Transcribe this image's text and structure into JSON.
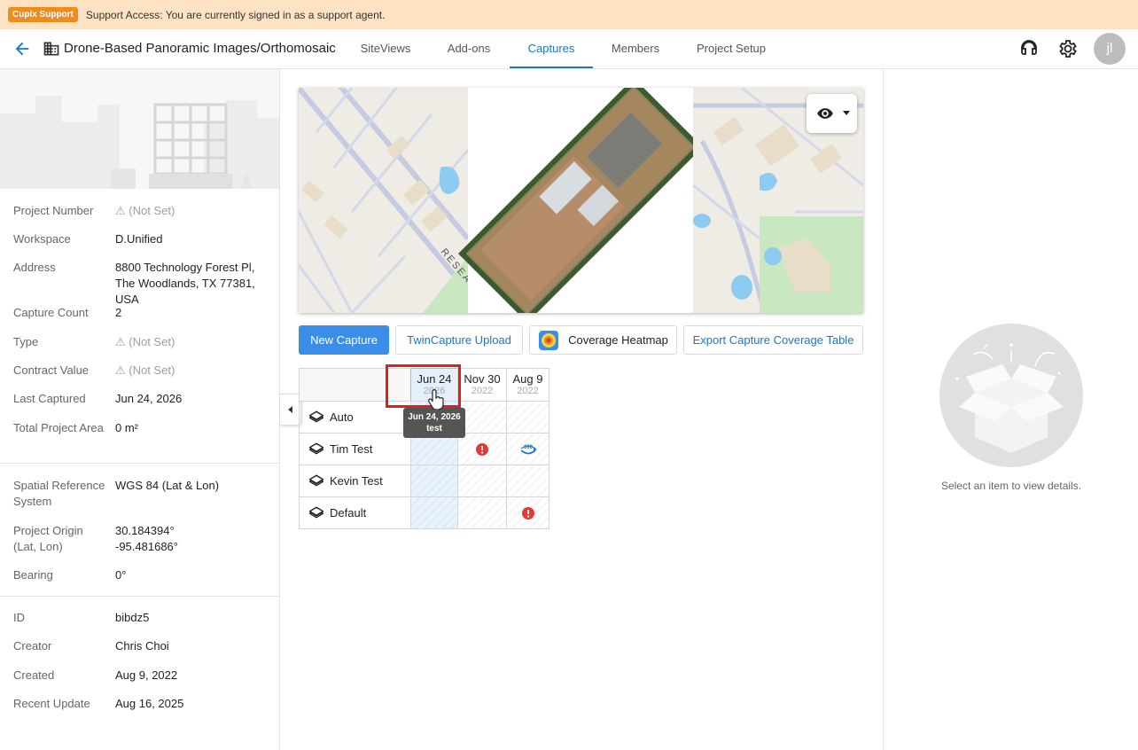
{
  "banner": {
    "badge": "Cupix Support",
    "message": "Support Access: You are currently signed in as a support agent."
  },
  "header": {
    "project_title": "Drone-Based Panoramic Images/Orthomosaic",
    "tabs": [
      {
        "label": "SiteViews"
      },
      {
        "label": "Add-ons"
      },
      {
        "label": "Captures",
        "active": true
      },
      {
        "label": "Members"
      },
      {
        "label": "Project Setup"
      }
    ],
    "avatar_initials": "jl"
  },
  "properties": {
    "project_number": {
      "label": "Project Number",
      "value": "⚠ (Not Set)"
    },
    "workspace": {
      "label": "Workspace",
      "value": "D.Unified"
    },
    "address": {
      "label": "Address",
      "value": "8800 Technology Forest Pl, The Woodlands, TX 77381, USA"
    },
    "capture_count": {
      "label": "Capture Count",
      "value": "2"
    },
    "type": {
      "label": "Type",
      "value": "⚠ (Not Set)"
    },
    "contract_value": {
      "label": "Contract Value",
      "value": "⚠ (Not Set)"
    },
    "last_captured": {
      "label": "Last Captured",
      "value": "Jun 24, 2026"
    },
    "total_area": {
      "label": "Total Project Area",
      "value": "0 m²"
    },
    "spatial_ref": {
      "label": "Spatial Reference System",
      "value": "WGS 84 (Lat & Lon)"
    },
    "origin": {
      "label": "Project Origin (Lat, Lon)",
      "lat": "30.184394°",
      "lon": "-95.481686°"
    },
    "bearing": {
      "label": "Bearing",
      "value": "0°"
    },
    "id": {
      "label": "ID",
      "value": "bibdz5"
    },
    "creator": {
      "label": "Creator",
      "value": "Chris Choi"
    },
    "created": {
      "label": "Created",
      "value": "Aug 9, 2022"
    },
    "recent_update": {
      "label": "Recent Update",
      "value": "Aug 16, 2025"
    }
  },
  "map": {
    "street_label": "RESEARCH FOR"
  },
  "actions": {
    "new_capture": "New Capture",
    "twincapture_upload": "TwinCapture Upload",
    "coverage_heatmap": "Coverage Heatmap",
    "export_table": "Export Capture Coverage Table"
  },
  "grid": {
    "columns": [
      {
        "date": "Jun 24",
        "year": "2026"
      },
      {
        "date": "Nov 30",
        "year": "2022"
      },
      {
        "date": "Aug 9",
        "year": "2022"
      }
    ],
    "rows": [
      {
        "label": "Auto"
      },
      {
        "label": "Tim Test"
      },
      {
        "label": "Kevin Test"
      },
      {
        "label": "Default"
      }
    ],
    "tooltip": {
      "line1": "Jun 24, 2026",
      "line2": "test"
    },
    "badge_360": "360"
  },
  "details": {
    "empty_text": "Select an item to view details."
  },
  "colors": {
    "accent": "#1976d2",
    "primary_button": "#3b8ee8",
    "banner": "#fde3c2",
    "error": "#e53935"
  }
}
